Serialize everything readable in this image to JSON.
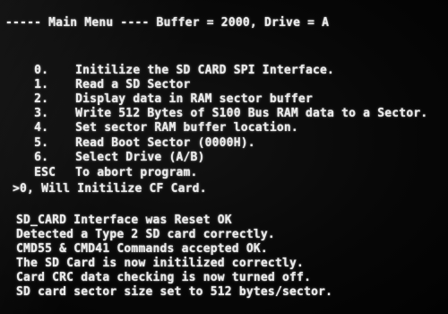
{
  "header": "----- Main Menu ---- Buffer = 2000, Drive = A",
  "menu": [
    {
      "key": "0.",
      "label": "Initilize the SD CARD SPI Interface."
    },
    {
      "key": "1.",
      "label": "Read a SD Sector"
    },
    {
      "key": "2.",
      "label": "Display data in RAM sector buffer"
    },
    {
      "key": "3.",
      "label": "Write 512 Bytes of S100 Bus RAM data to a Sector."
    },
    {
      "key": "4.",
      "label": "Set sector RAM buffer location."
    },
    {
      "key": "5.",
      "label": "Read Boot Sector (0000H)."
    },
    {
      "key": "6.",
      "label": "Select Drive (A/B)"
    },
    {
      "key": "ESC",
      "label": "To abort program."
    }
  ],
  "command_echo": ">0, Will Initilize CF Card.",
  "output": [
    "SD_CARD Interface was Reset OK",
    "Detected a Type 2 SD card correctly.",
    "CMD55 & CMD41 Commands accepted OK.",
    "The SD Card is now initilized correctly.",
    "Card CRC data checking is now turned off.",
    "SD card sector size set to 512 bytes/sector."
  ]
}
